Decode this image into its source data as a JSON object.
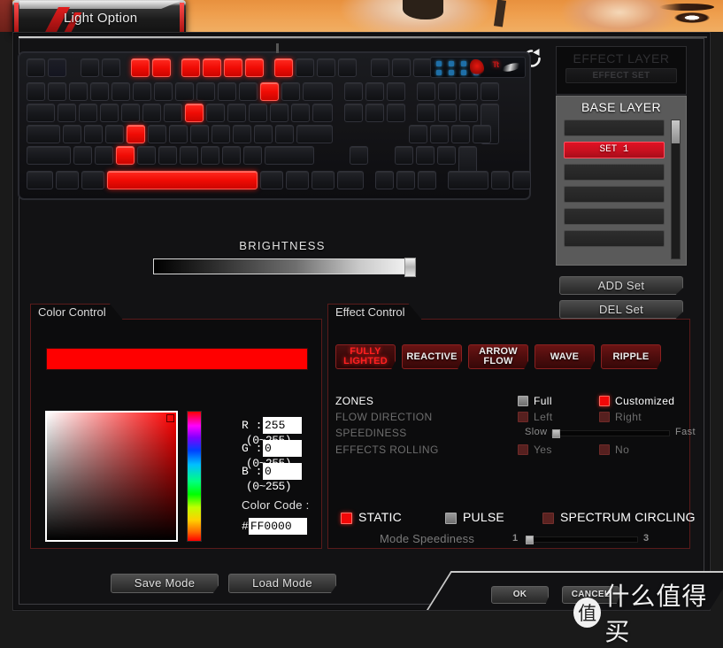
{
  "tab": {
    "label": "Light Option"
  },
  "toolbar": {
    "refresh_icon": "refresh-icon"
  },
  "keyboard": {
    "rows": [
      {
        "keys": [
          {
            "w": 21,
            "lit": false
          },
          {
            "w": 21,
            "dim": true
          },
          {
            "gap": 10
          },
          {
            "w": 21,
            "lit": false
          },
          {
            "w": 21,
            "lit": false
          },
          {
            "gap": 6
          },
          {
            "w": 21,
            "lit": true
          },
          {
            "w": 21,
            "lit": true
          },
          {
            "gap": 6
          },
          {
            "w": 21,
            "lit": true
          },
          {
            "w": 21,
            "lit": true
          },
          {
            "w": 21,
            "lit": true
          },
          {
            "w": 21,
            "lit": true
          },
          {
            "gap": 6
          },
          {
            "w": 21,
            "lit": true
          },
          {
            "w": 21,
            "lit": false
          },
          {
            "w": 21,
            "lit": false
          },
          {
            "w": 21,
            "lit": false
          },
          {
            "gap": 10
          },
          {
            "w": 21,
            "lit": false
          },
          {
            "w": 21,
            "lit": false
          },
          {
            "w": 21,
            "lit": false
          }
        ]
      },
      {
        "keys": [
          {
            "w": 21
          },
          {
            "w": 21
          },
          {
            "w": 21
          },
          {
            "w": 21
          },
          {
            "w": 21
          },
          {
            "w": 21
          },
          {
            "w": 21
          },
          {
            "w": 21
          },
          {
            "w": 21
          },
          {
            "w": 21
          },
          {
            "w": 21
          },
          {
            "w": 21,
            "lit": true
          },
          {
            "w": 21
          },
          {
            "w": 34
          },
          {
            "gap": 7
          },
          {
            "w": 21
          },
          {
            "w": 21
          },
          {
            "w": 21
          },
          {
            "gap": 7
          },
          {
            "w": 21
          },
          {
            "w": 21
          },
          {
            "w": 21
          },
          {
            "w": 21
          }
        ]
      },
      {
        "keys": [
          {
            "w": 32
          },
          {
            "w": 21
          },
          {
            "w": 21
          },
          {
            "w": 21
          },
          {
            "w": 21
          },
          {
            "w": 21
          },
          {
            "w": 21
          },
          {
            "w": 21,
            "lit": true
          },
          {
            "w": 21
          },
          {
            "w": 21
          },
          {
            "w": 21
          },
          {
            "w": 21
          },
          {
            "w": 21
          },
          {
            "w": 23
          },
          {
            "gap": 7
          },
          {
            "w": 21
          },
          {
            "w": 21
          },
          {
            "w": 21
          },
          {
            "gap": 7
          },
          {
            "w": 21
          },
          {
            "w": 21
          },
          {
            "w": 21
          },
          {
            "w": 21,
            "h": 46
          }
        ]
      },
      {
        "keys": [
          {
            "w": 38
          },
          {
            "w": 21
          },
          {
            "w": 21
          },
          {
            "w": 21
          },
          {
            "w": 21,
            "lit": true
          },
          {
            "w": 21
          },
          {
            "w": 21
          },
          {
            "w": 21
          },
          {
            "w": 21
          },
          {
            "w": 21
          },
          {
            "w": 21
          },
          {
            "w": 21
          },
          {
            "w": 41
          },
          {
            "gap": 7
          },
          {
            "gap": 70
          },
          {
            "w": 21
          },
          {
            "w": 21
          },
          {
            "w": 21
          },
          {
            "w": 21
          }
        ]
      },
      {
        "keys": [
          {
            "w": 50
          },
          {
            "w": 21
          },
          {
            "w": 21
          },
          {
            "w": 21,
            "lit": true
          },
          {
            "w": 21
          },
          {
            "w": 21
          },
          {
            "w": 21
          },
          {
            "w": 21
          },
          {
            "w": 21
          },
          {
            "w": 21
          },
          {
            "w": 56
          },
          {
            "gap": 7
          },
          {
            "gap": 24
          },
          {
            "w": 21
          },
          {
            "gap": 24
          },
          {
            "w": 21
          },
          {
            "w": 21
          },
          {
            "w": 21
          },
          {
            "w": 21,
            "h": 46
          }
        ]
      },
      {
        "keys": [
          {
            "w": 30
          },
          {
            "w": 26
          },
          {
            "w": 26
          },
          {
            "w": 170,
            "lit": true
          },
          {
            "w": 26
          },
          {
            "w": 26
          },
          {
            "w": 26
          },
          {
            "w": 30
          },
          {
            "gap": 7
          },
          {
            "w": 21
          },
          {
            "w": 21
          },
          {
            "w": 21
          },
          {
            "gap": 7
          },
          {
            "w": 46
          },
          {
            "w": 21
          },
          {
            "w": 21
          }
        ]
      }
    ],
    "indicator_leds": 8,
    "brand": "Tt"
  },
  "brightness": {
    "label": "BRIGHTNESS",
    "value": 100
  },
  "effect_layer": {
    "title": "EFFECT LAYER",
    "effect_set_label": "EFFECT SET",
    "base_layer_title": "BASE LAYER",
    "sets": [
      {
        "label": "",
        "active": false
      },
      {
        "label": "SET 1",
        "active": true
      },
      {
        "label": "",
        "active": false
      },
      {
        "label": "",
        "active": false
      },
      {
        "label": "",
        "active": false
      },
      {
        "label": "",
        "active": false
      }
    ],
    "add_set_label": "ADD Set",
    "del_set_label": "DEL Set"
  },
  "color_control": {
    "title": "Color Control",
    "preview_color": "#FF0000",
    "r_label": "R :",
    "r_value": "255",
    "g_label": "G :",
    "g_value": "0",
    "b_label": "B :",
    "b_value": "0",
    "range_hint": "(0~255)",
    "color_code_label": "Color Code :",
    "hash": "#",
    "color_code_value": "FF0000"
  },
  "effect_control": {
    "title": "Effect Control",
    "buttons": [
      {
        "label": "FULLY LIGHTED",
        "line1": "FULLY",
        "line2": "LIGHTED",
        "active": true
      },
      {
        "label": "REACTIVE",
        "line1": "REACTIVE",
        "line2": "",
        "active": false
      },
      {
        "label": "ARROW FLOW",
        "line1": "ARROW",
        "line2": "FLOW",
        "active": false
      },
      {
        "label": "WAVE",
        "line1": "WAVE",
        "line2": "",
        "active": false
      },
      {
        "label": "RIPPLE",
        "line1": "RIPPLE",
        "line2": "",
        "active": false
      }
    ],
    "rows": {
      "zones": {
        "name": "ZONES",
        "enabled": true,
        "option1": "Full",
        "option1_state": "off",
        "option2": "Customized",
        "option2_state": "on"
      },
      "flow_direction": {
        "name": "FLOW DIRECTION",
        "enabled": false,
        "option1": "Left",
        "option1_state": "dis",
        "option2": "Right",
        "option2_state": "dis"
      },
      "speediness": {
        "name": "SPEEDINESS",
        "enabled": false,
        "min_label": "Slow",
        "max_label": "Fast",
        "value": 0
      },
      "effects_rolling": {
        "name": "EFFECTS ROLLING",
        "enabled": false,
        "option1": "Yes",
        "option1_state": "dis",
        "option2": "No",
        "option2_state": "dis"
      }
    },
    "modes": [
      {
        "label": "STATIC",
        "state": "on"
      },
      {
        "label": "PULSE",
        "state": "off"
      },
      {
        "label": "SPECTRUM CIRCLING",
        "state": "dis"
      }
    ],
    "mode_speediness": {
      "label": "Mode Speediness",
      "min_label": "1",
      "max_label": "3",
      "value": 1
    }
  },
  "footer": {
    "save_mode_label": "Save Mode",
    "load_mode_label": "Load Mode",
    "ok_label": "OK",
    "cancel_label": "CANCEL"
  },
  "watermark": {
    "mark": "值",
    "text": "什么值得买"
  }
}
